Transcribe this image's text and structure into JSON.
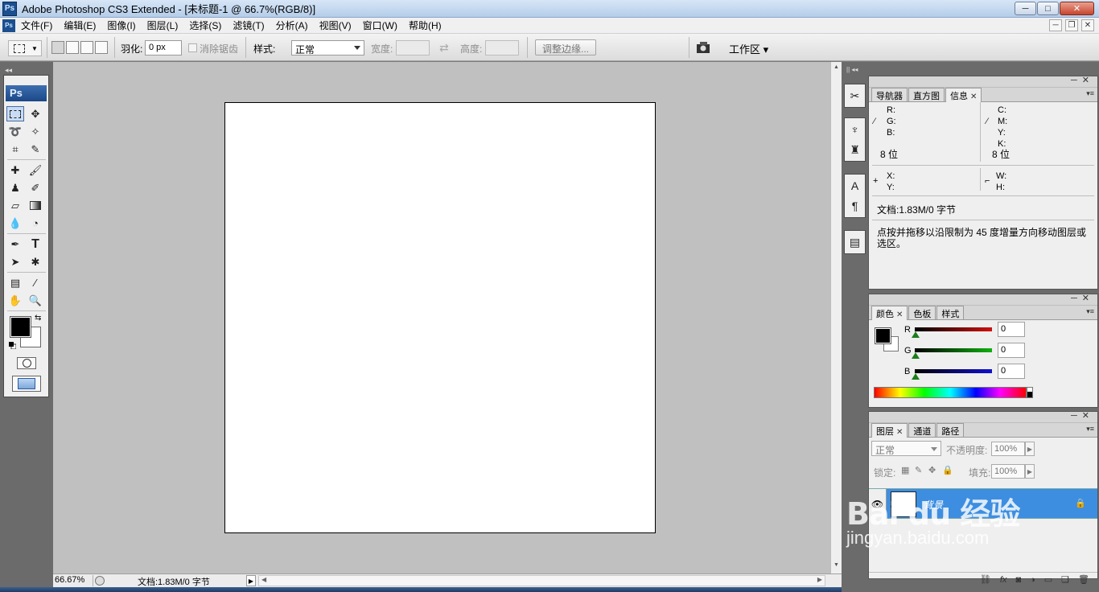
{
  "window": {
    "title": "Adobe Photoshop CS3 Extended - [未标题-1 @ 66.7%(RGB/8)]",
    "icon_text": "Ps",
    "min_glyph": "─",
    "max_glyph": "□",
    "close_glyph": "✕"
  },
  "menu": {
    "items": [
      "文件(F)",
      "编辑(E)",
      "图像(I)",
      "图层(L)",
      "选择(S)",
      "滤镜(T)",
      "分析(A)",
      "视图(V)",
      "窗口(W)",
      "帮助(H)"
    ],
    "ctl_min": "─",
    "ctl_restore": "❐",
    "ctl_close": "✕"
  },
  "options": {
    "feather_label": "羽化:",
    "feather_value": "0 px",
    "antialias_label": "消除锯齿",
    "style_label": "样式:",
    "style_value": "正常",
    "width_label": "宽度:",
    "height_label": "高度:",
    "refine_button": "调整边缘...",
    "workspace_label": "工作区 ▾"
  },
  "toolbox": {
    "logo": "Ps",
    "tools": [
      "marquee-tool",
      "move-tool",
      "lasso-tool",
      "magic-wand-tool",
      "crop-tool",
      "slice-tool",
      "healing-brush-tool",
      "brush-tool",
      "clone-stamp-tool",
      "history-brush-tool",
      "eraser-tool",
      "gradient-tool",
      "blur-tool",
      "dodge-tool",
      "pen-tool",
      "type-tool",
      "path-selection-tool",
      "shape-tool",
      "notes-tool",
      "eyedropper-tool",
      "hand-tool",
      "zoom-tool"
    ],
    "foreground_color": "#000000",
    "background_color": "#ffffff"
  },
  "document": {
    "canvas_color": "#ffffff",
    "workspace_color": "#c0c0c0"
  },
  "status": {
    "zoom": "66.67%",
    "doc_info": "文档:1.83M/0 字节"
  },
  "info_panel": {
    "tabs": [
      "导航器",
      "直方图",
      "信息"
    ],
    "active_tab": "信息",
    "rgb_r": "R:",
    "rgb_g": "G:",
    "rgb_b": "B:",
    "cmyk_c": "C:",
    "cmyk_m": "M:",
    "cmyk_y": "Y:",
    "cmyk_k": "K:",
    "bits_left": "8 位",
    "bits_right": "8 位",
    "x_label": "X:",
    "y_label": "Y:",
    "w_label": "W:",
    "h_label": "H:",
    "doc_info": "文档:1.83M/0 字节",
    "hint": "点按并拖移以沿限制为 45 度增量方向移动图层或选区。"
  },
  "color_panel": {
    "tabs": [
      "颜色",
      "色板",
      "样式"
    ],
    "active_tab": "颜色",
    "r_label": "R",
    "g_label": "G",
    "b_label": "B",
    "r_value": "0",
    "g_value": "0",
    "b_value": "0",
    "r_color": "#d01010",
    "g_color": "#10b010",
    "b_color": "#1010d0"
  },
  "layers_panel": {
    "tabs": [
      "图层",
      "通道",
      "路径"
    ],
    "active_tab": "图层",
    "blend_mode": "正常",
    "opacity_label": "不透明度:",
    "opacity_value": "100%",
    "lock_label": "锁定:",
    "fill_label": "填充:",
    "fill_value": "100%",
    "layer_name": "背景",
    "selection_color": "#3d8ee0",
    "footer_icons": [
      "link-icon",
      "fx-icon",
      "mask-icon",
      "adjustment-icon",
      "group-icon",
      "new-layer-icon",
      "trash-icon"
    ]
  },
  "watermark": {
    "text": "Bai du 经验",
    "url": "jingyan.baidu.com"
  }
}
